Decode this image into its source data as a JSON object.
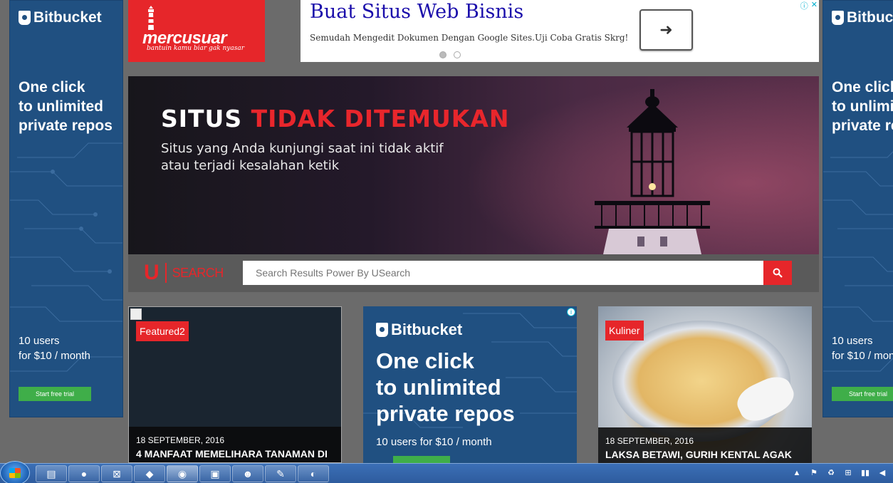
{
  "side_ad": {
    "brand": "Bitbucket",
    "headline": "One click\nto unlimited\nprivate repos",
    "price": "10 users\nfor $10 / month",
    "cta": "Start free trial"
  },
  "logo": {
    "name": "mercusuar",
    "tagline": "bantuin kamu biar gak nyasar"
  },
  "top_ad": {
    "title": "Buat Situs Web Bisnis",
    "description": "Semudah Mengedit Dokumen Dengan Google Sites.Uji Coba Gratis Skrg!",
    "arrow": "➜",
    "choices_info": "ⓘ",
    "choices_close": "✕"
  },
  "hero": {
    "title_white": "SITUS ",
    "title_red": "TIDAK DITEMUKAN",
    "subtitle": "Situs yang Anda kunjungi saat ini tidak aktif\natau terjadi kesalahan ketik"
  },
  "search": {
    "logo_u": "U",
    "logo_text": "SEARCH",
    "placeholder": "Search Results Power By USearch"
  },
  "cards": [
    {
      "badge": "Featured2",
      "date": "18 SEPTEMBER, 2016",
      "title": "4 MANFAAT MEMELIHARA TANAMAN DI"
    },
    {
      "badge": "Kuliner",
      "date": "18 SEPTEMBER, 2016",
      "title": "LAKSA BETAWI, GURIH KENTAL AGAK"
    }
  ],
  "mid_ad": {
    "brand": "Bitbucket",
    "headline": "One click\nto unlimited\nprivate repos",
    "price": "10 users for $10 / month",
    "info": "i"
  },
  "taskbar": {
    "buttons": [
      "explorer",
      "firefox",
      "xampp",
      "app",
      "chrome",
      "terminal",
      "gimp",
      "notepad",
      "paint"
    ],
    "tray_icons": [
      "▲",
      "⚑",
      "♻",
      "⊞",
      "▮▮",
      "◀"
    ]
  }
}
